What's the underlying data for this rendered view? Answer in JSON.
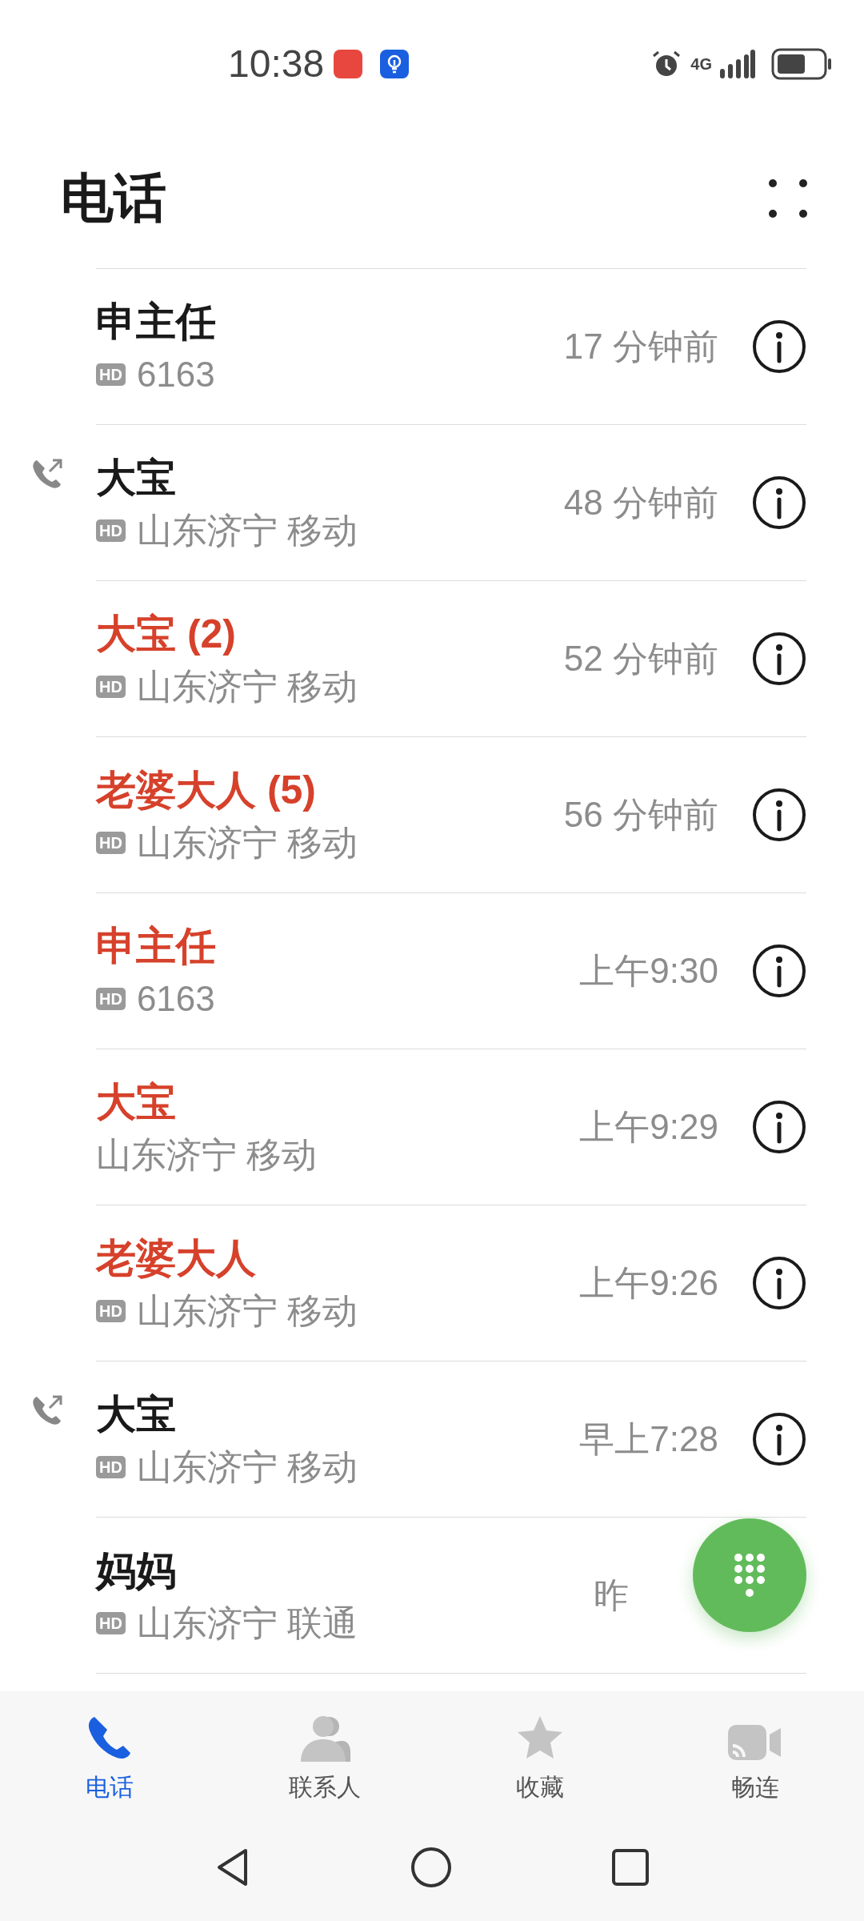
{
  "status_bar": {
    "time": "10:38",
    "network": "4G"
  },
  "title": "电话",
  "calls": [
    {
      "name": "申主任",
      "missed": false,
      "outgoing": false,
      "hd_badge": "HD",
      "detail": "6163",
      "time": "17 分钟前"
    },
    {
      "name": "大宝",
      "missed": false,
      "outgoing": true,
      "hd_badge": "HD",
      "detail": "山东济宁 移动",
      "time": "48 分钟前"
    },
    {
      "name": "大宝 (2)",
      "missed": true,
      "outgoing": false,
      "hd_badge": "HD",
      "detail": "山东济宁 移动",
      "time": "52 分钟前"
    },
    {
      "name": "老婆大人 (5)",
      "missed": true,
      "outgoing": false,
      "hd_badge": "HD",
      "detail": "山东济宁 移动",
      "time": "56 分钟前"
    },
    {
      "name": "申主任",
      "missed": true,
      "outgoing": false,
      "hd_badge": "HD",
      "detail": "6163",
      "time": "上午9:30"
    },
    {
      "name": "大宝",
      "missed": true,
      "outgoing": false,
      "detail": "山东济宁 移动",
      "time": "上午9:29"
    },
    {
      "name": "老婆大人",
      "missed": true,
      "outgoing": false,
      "hd_badge": "HD",
      "detail": "山东济宁 移动",
      "time": "上午9:26"
    },
    {
      "name": "大宝",
      "missed": false,
      "outgoing": true,
      "hd_badge": "HD",
      "detail": "山东济宁 移动",
      "time": "早上7:28"
    },
    {
      "name": "妈妈",
      "missed": false,
      "outgoing": false,
      "hd_badge": "HD",
      "detail": "山东济宁 联通",
      "time": "昨",
      "under_dialpad": true
    }
  ],
  "tabs": [
    {
      "kind": "phone",
      "label": "电话",
      "selected": true
    },
    {
      "kind": "contacts",
      "label": "联系人",
      "selected": false
    },
    {
      "kind": "favorites",
      "label": "收藏",
      "selected": false
    },
    {
      "kind": "meetime",
      "label": "畅连",
      "selected": false
    }
  ]
}
